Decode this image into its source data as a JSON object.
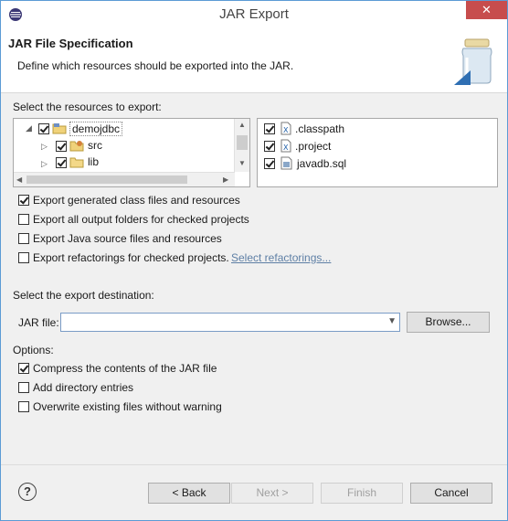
{
  "window": {
    "title": "JAR Export",
    "close_glyph": "✕"
  },
  "header": {
    "title": "JAR File Specification",
    "description": "Define which resources should be exported into the JAR."
  },
  "resources": {
    "label": "Select the resources to export:",
    "tree": [
      {
        "label": "demojdbc",
        "icon": "project-folder-icon",
        "checked": true,
        "expanded": true
      },
      {
        "label": "src",
        "icon": "source-folder-icon",
        "checked": true,
        "expanded": false
      },
      {
        "label": "lib",
        "icon": "folder-icon",
        "checked": true,
        "expanded": false
      }
    ],
    "files": [
      {
        "label": ".classpath",
        "icon": "xml-file-icon",
        "checked": true
      },
      {
        "label": ".project",
        "icon": "xml-file-icon",
        "checked": true
      },
      {
        "label": "javadb.sql",
        "icon": "sql-file-icon",
        "checked": true
      }
    ]
  },
  "export_options": [
    {
      "label": "Export generated class files and resources",
      "checked": true
    },
    {
      "label": "Export all output folders for checked projects",
      "checked": false
    },
    {
      "label": "Export Java source files and resources",
      "checked": false
    },
    {
      "label": "Export refactorings for checked projects.",
      "checked": false
    }
  ],
  "select_refactorings_link": "Select refactorings...",
  "destination": {
    "label": "Select the export destination:",
    "jar_file_label": "JAR file:",
    "jar_file_value": "",
    "browse_label": "Browse..."
  },
  "options": {
    "label": "Options:",
    "items": [
      {
        "label": "Compress the contents of the JAR file",
        "checked": true
      },
      {
        "label": "Add directory entries",
        "checked": false
      },
      {
        "label": "Overwrite existing files without warning",
        "checked": false
      }
    ]
  },
  "footer": {
    "help_glyph": "?",
    "back_label": "< Back",
    "next_label": "Next >",
    "finish_label": "Finish",
    "cancel_label": "Cancel"
  },
  "colors": {
    "accent": "#5b9bd5",
    "close": "#c74d4d",
    "link": "#5e7fa5"
  }
}
